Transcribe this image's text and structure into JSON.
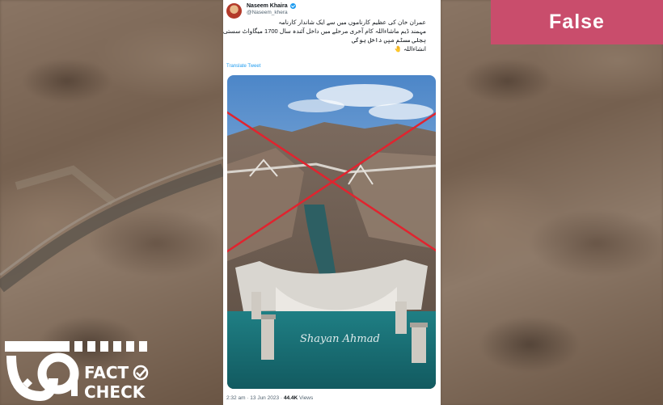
{
  "verdict": {
    "label": "False",
    "color": "#c94d6c"
  },
  "tweet": {
    "author_name": "Naseem Khaira",
    "author_handle": "@Naseem_khera",
    "text_lines": [
      "عمران خان کی عظیم کارناموں میں سے ایک شاندار کارنامہ",
      "مہمند ڈیم ماشاءاللہ کام آخری مرحلے میں داخل آئندہ سال 1700 میگاواٹ سستی",
      "بجلی سسٹم میں داخل ہوگی",
      "انشاءاللہ 🤚"
    ],
    "translate_label": "Translate Tweet",
    "image_watermark": "Shayan Ahmad",
    "time": "2:32 am",
    "date": "13 Jun 2023",
    "views_count": "44.4K",
    "views_label": "Views"
  },
  "logo": {
    "line1": "FACT",
    "line2": "CHECK"
  },
  "icons": [
    "verified-badge-icon",
    "cross-out-mark-icon",
    "fact-check-logo-icon"
  ]
}
